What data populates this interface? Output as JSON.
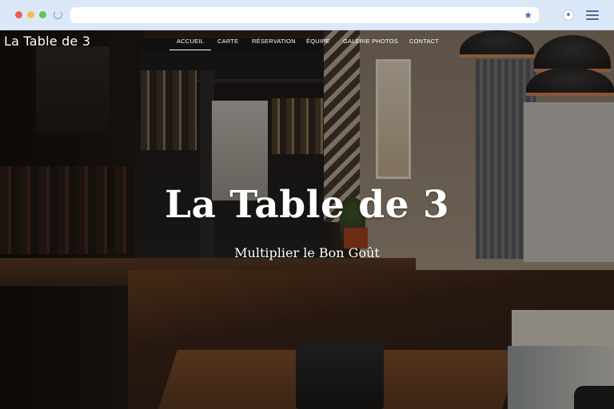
{
  "browser": {
    "url": "",
    "icons": [
      "close-dot",
      "minimize-dot",
      "maximize-dot",
      "reload-icon",
      "bookmark-star-icon",
      "profile-icon",
      "menu-icon"
    ]
  },
  "site": {
    "brand": "La Table de 3",
    "nav": [
      {
        "label": "Accueil",
        "active": true
      },
      {
        "label": "Carte",
        "active": false
      },
      {
        "label": "Réservation",
        "active": false
      },
      {
        "label": "Équipe",
        "active": false
      },
      {
        "label": "Galerie photos",
        "active": false
      },
      {
        "label": "Contact",
        "active": false
      }
    ]
  },
  "hero": {
    "title": "La Table de 3",
    "subtitle": "Multiplier le Bon Goût"
  },
  "colors": {
    "chrome_bg": "#dbe8f8",
    "accent": "#ffffff",
    "star": "#3d6fb0"
  }
}
